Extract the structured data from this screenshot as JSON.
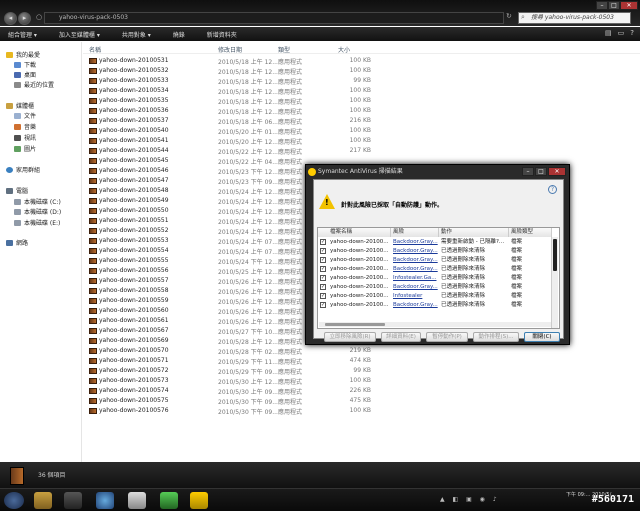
{
  "window": {
    "address": "yahoo-virus-pack-0503",
    "search_placeholder": "搜尋 yahoo-virus-pack-0503"
  },
  "toolbar": {
    "items": [
      "組合管理 ▾",
      "加入至媒體櫃 ▾",
      "共用對象 ▾",
      "燒錄",
      "新增資料夾"
    ]
  },
  "sidebar": {
    "favorites": "我的最愛",
    "fav_items": [
      "下載",
      "桌面",
      "最近的位置"
    ],
    "libraries": "媒體櫃",
    "lib_items": [
      "文件",
      "音樂",
      "視訊",
      "圖片"
    ],
    "homegroup": "家用群組",
    "computer": "電腦",
    "drives": [
      "本機磁碟 (C:)",
      "本機磁碟 (D:)",
      "本機磁碟 (E:)"
    ],
    "network": "網路"
  },
  "columns": {
    "name": "名稱",
    "date": "修改日期",
    "type": "類型",
    "size": "大小"
  },
  "files": [
    {
      "name": "yahoo-down-20100531",
      "date": "2010/5/18 上午 12...",
      "type": "應用程式",
      "size": "100 KB"
    },
    {
      "name": "yahoo-down-20100532",
      "date": "2010/5/18 上午 12...",
      "type": "應用程式",
      "size": "100 KB"
    },
    {
      "name": "yahoo-down-20100533",
      "date": "2010/5/18 上午 12...",
      "type": "應用程式",
      "size": "99 KB"
    },
    {
      "name": "yahoo-down-20100534",
      "date": "2010/5/18 上午 12...",
      "type": "應用程式",
      "size": "100 KB"
    },
    {
      "name": "yahoo-down-20100535",
      "date": "2010/5/18 上午 12...",
      "type": "應用程式",
      "size": "100 KB"
    },
    {
      "name": "yahoo-down-20100536",
      "date": "2010/5/18 上午 12...",
      "type": "應用程式",
      "size": "100 KB"
    },
    {
      "name": "yahoo-down-20100537",
      "date": "2010/5/18 上午 06...",
      "type": "應用程式",
      "size": "216 KB"
    },
    {
      "name": "yahoo-down-20100540",
      "date": "2010/5/20 上午 01...",
      "type": "應用程式",
      "size": "100 KB"
    },
    {
      "name": "yahoo-down-20100541",
      "date": "2010/5/20 上午 12...",
      "type": "應用程式",
      "size": "100 KB"
    },
    {
      "name": "yahoo-down-20100544",
      "date": "2010/5/22 上午 12...",
      "type": "應用程式",
      "size": "217 KB"
    },
    {
      "name": "yahoo-down-20100545",
      "date": "2010/5/22 上午 04...",
      "type": "應用程式",
      "size": ""
    },
    {
      "name": "yahoo-down-20100546",
      "date": "2010/5/23 下午 12...",
      "type": "應用程式",
      "size": ""
    },
    {
      "name": "yahoo-down-20100547",
      "date": "2010/5/23 下午 09...",
      "type": "應用程式",
      "size": ""
    },
    {
      "name": "yahoo-down-20100548",
      "date": "2010/5/24 上午 12...",
      "type": "應用程式",
      "size": ""
    },
    {
      "name": "yahoo-down-20100549",
      "date": "2010/5/24 上午 12...",
      "type": "應用程式",
      "size": ""
    },
    {
      "name": "yahoo-down-20100550",
      "date": "2010/5/24 上午 12...",
      "type": "應用程式",
      "size": ""
    },
    {
      "name": "yahoo-down-20100551",
      "date": "2010/5/24 上午 12...",
      "type": "應用程式",
      "size": ""
    },
    {
      "name": "yahoo-down-20100552",
      "date": "2010/5/24 上午 12...",
      "type": "應用程式",
      "size": ""
    },
    {
      "name": "yahoo-down-20100553",
      "date": "2010/5/24 上午 07...",
      "type": "應用程式",
      "size": ""
    },
    {
      "name": "yahoo-down-20100554",
      "date": "2010/5/24 上午 07...",
      "type": "應用程式",
      "size": ""
    },
    {
      "name": "yahoo-down-20100555",
      "date": "2010/5/24 下午 12...",
      "type": "應用程式",
      "size": ""
    },
    {
      "name": "yahoo-down-20100556",
      "date": "2010/5/25 上午 12...",
      "type": "應用程式",
      "size": ""
    },
    {
      "name": "yahoo-down-20100557",
      "date": "2010/5/26 上午 12...",
      "type": "應用程式",
      "size": ""
    },
    {
      "name": "yahoo-down-20100558",
      "date": "2010/5/26 上午 12...",
      "type": "應用程式",
      "size": ""
    },
    {
      "name": "yahoo-down-20100559",
      "date": "2010/5/26 上午 12...",
      "type": "應用程式",
      "size": ""
    },
    {
      "name": "yahoo-down-20100560",
      "date": "2010/5/26 上午 12...",
      "type": "應用程式",
      "size": ""
    },
    {
      "name": "yahoo-down-20100561",
      "date": "2010/5/26 上午 12...",
      "type": "應用程式",
      "size": ""
    },
    {
      "name": "yahoo-down-20100567",
      "date": "2010/5/27 下午 10...",
      "type": "應用程式",
      "size": "100 KB"
    },
    {
      "name": "yahoo-down-20100569",
      "date": "2010/5/28 上午 12...",
      "type": "應用程式",
      "size": "146 KB"
    },
    {
      "name": "yahoo-down-20100570",
      "date": "2010/5/28 下午 02...",
      "type": "應用程式",
      "size": "219 KB"
    },
    {
      "name": "yahoo-down-20100571",
      "date": "2010/5/29 下午 11...",
      "type": "應用程式",
      "size": "474 KB"
    },
    {
      "name": "yahoo-down-20100572",
      "date": "2010/5/29 下午 09...",
      "type": "應用程式",
      "size": "99 KB"
    },
    {
      "name": "yahoo-down-20100573",
      "date": "2010/5/30 上午 12...",
      "type": "應用程式",
      "size": "100 KB"
    },
    {
      "name": "yahoo-down-20100574",
      "date": "2010/5/30 上午 09...",
      "type": "應用程式",
      "size": "226 KB"
    },
    {
      "name": "yahoo-down-20100575",
      "date": "2010/5/30 下午 09...",
      "type": "應用程式",
      "size": "475 KB"
    },
    {
      "name": "yahoo-down-20100576",
      "date": "2010/5/30 下午 09...",
      "type": "應用程式",
      "size": "100 KB"
    }
  ],
  "status": {
    "count": "36 個項目"
  },
  "dialog": {
    "title": "Symantec AntiVirus 掃描結果",
    "message": "針對此風險已採取「自動防護」動作。",
    "headers": [
      "檔案名稱",
      "風險",
      "動作",
      "風險類型"
    ],
    "rows": [
      {
        "file": "yahoo-down-20100...",
        "risk": "Backdoor.Gray...",
        "action": "需要重新啟動 - 已隔離?...",
        "type": "檔案"
      },
      {
        "file": "yahoo-down-20100...",
        "risk": "Backdoor.Gray...",
        "action": "已透過刪除來清除",
        "type": "檔案"
      },
      {
        "file": "yahoo-down-20100...",
        "risk": "Backdoor.Gray...",
        "action": "已透過刪除來清除",
        "type": "檔案"
      },
      {
        "file": "yahoo-down-20100...",
        "risk": "Backdoor.Gray...",
        "action": "已透過刪除來清除",
        "type": "檔案"
      },
      {
        "file": "yahoo-down-20100...",
        "risk": "Infostealer.Ga...",
        "action": "已透過刪除來清除",
        "type": "檔案"
      },
      {
        "file": "yahoo-down-20100...",
        "risk": "Backdoor.Gray...",
        "action": "已透過刪除來清除",
        "type": "檔案"
      },
      {
        "file": "yahoo-down-20100...",
        "risk": "Infostealer",
        "action": "已透過刪除來清除",
        "type": "檔案"
      },
      {
        "file": "yahoo-down-20100...",
        "risk": "Backdoor.Gray...",
        "action": "已透過刪除來清除",
        "type": "檔案"
      }
    ],
    "buttons": [
      "立即移除風險(R)",
      "詳細資料(E)",
      "暫停動作(P)",
      "動作排程(S)...",
      "關閉(C)"
    ]
  },
  "taskbar": {
    "clock": "下午 09:... 2010/5/..."
  },
  "watermark": "#560171"
}
